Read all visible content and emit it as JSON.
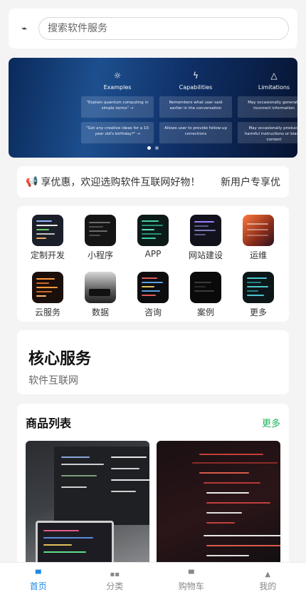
{
  "search": {
    "logo": "⌁",
    "placeholder": "搜索软件服务"
  },
  "banner": {
    "columns": [
      {
        "icon": "☼",
        "title": "Examples",
        "items": [
          "\"Explain quantum computing in simple terms\" →",
          "\"Got any creative ideas for a 10 year old's birthday?\" →"
        ]
      },
      {
        "icon": "ϟ",
        "title": "Capabilities",
        "items": [
          "Remembers what user said earlier in the conversation",
          "Allows user to provide follow-up corrections"
        ]
      },
      {
        "icon": "△",
        "title": "Limitations",
        "items": [
          "May occasionally generate incorrect information",
          "May occasionally produce harmful instructions or biased content"
        ]
      }
    ]
  },
  "notice": {
    "icon": "📢",
    "text": "享优惠，欢迎选购软件互联网好物！",
    "tag": "新用户专享优"
  },
  "categories": [
    {
      "label": "定制开发"
    },
    {
      "label": "小程序"
    },
    {
      "label": "APP"
    },
    {
      "label": "网站建设"
    },
    {
      "label": "运维"
    },
    {
      "label": "云服务"
    },
    {
      "label": "数据"
    },
    {
      "label": "咨询"
    },
    {
      "label": "案例"
    },
    {
      "label": "更多"
    }
  ],
  "core": {
    "title": "核心服务",
    "subtitle": "软件互联网"
  },
  "products": {
    "title": "商品列表",
    "more": "更多"
  },
  "tabs": [
    {
      "icon": "▀",
      "label": "首页"
    },
    {
      "icon": "▪▪",
      "label": "分类"
    },
    {
      "icon": "▀",
      "label": "购物车"
    },
    {
      "icon": "▲",
      "label": "我的"
    }
  ],
  "colors": {
    "accent": "#1e88e5",
    "more": "#19b35a"
  }
}
